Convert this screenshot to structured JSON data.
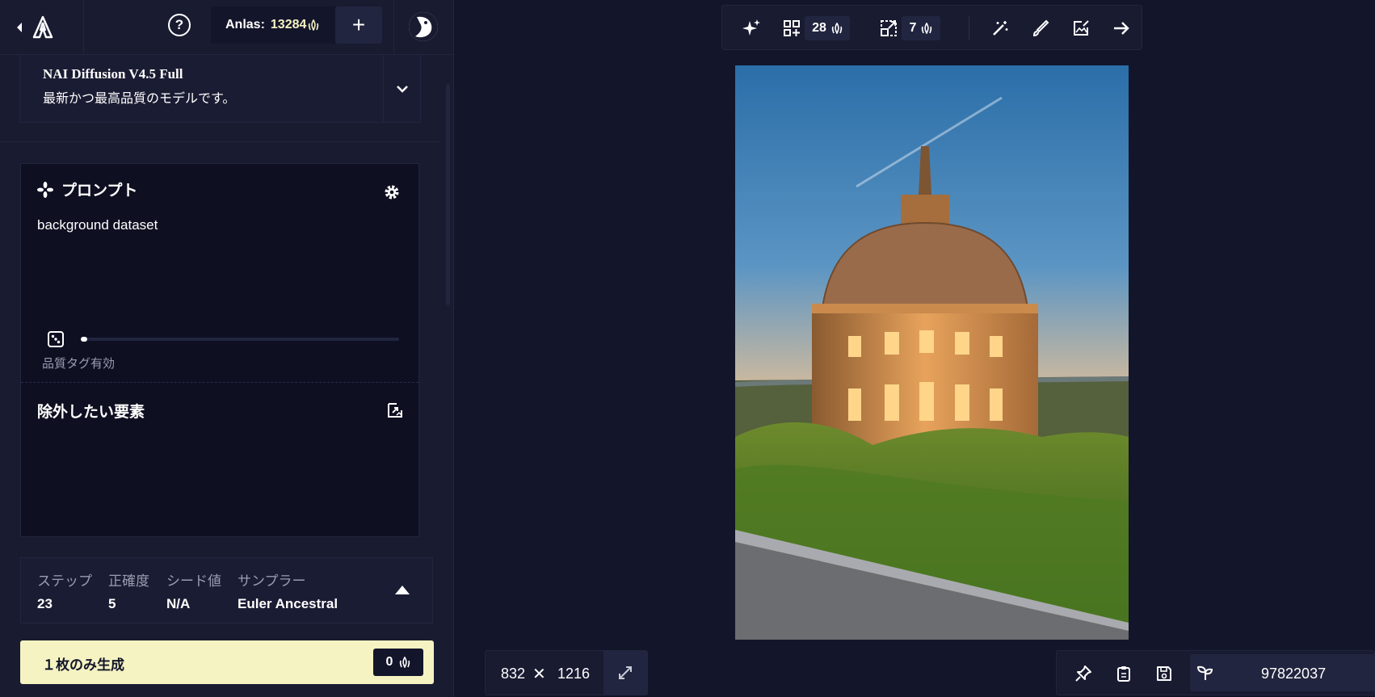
{
  "header": {
    "anlas_label": "Anlas:",
    "anlas_value": "13284",
    "add_label": "+"
  },
  "model": {
    "name": "NAI Diffusion V4.5 Full",
    "description": "最新かつ最高品質のモデルです。"
  },
  "prompt": {
    "title": "プロンプト",
    "text": "background dataset",
    "quality_tag": "品質タグ有効",
    "slider_value": 0.02
  },
  "negative": {
    "title": "除外したい要素"
  },
  "params": {
    "steps_label": "ステップ",
    "steps_value": "23",
    "guidance_label": "正確度",
    "guidance_value": "5",
    "seed_label": "シード値",
    "seed_value": "N/A",
    "sampler_label": "サンプラー",
    "sampler_value": "Euler Ancestral"
  },
  "generate": {
    "label": "１枚のみ生成",
    "cost": "0"
  },
  "toolbar": {
    "variations_cost": "28",
    "upscale_cost": "7"
  },
  "image_size": {
    "width": "832",
    "times": "✕",
    "height": "1216"
  },
  "seed": {
    "value": "97822037"
  },
  "colors": {
    "background": "#13152a",
    "panel": "#191b31",
    "accent": "#f5f3c2"
  }
}
